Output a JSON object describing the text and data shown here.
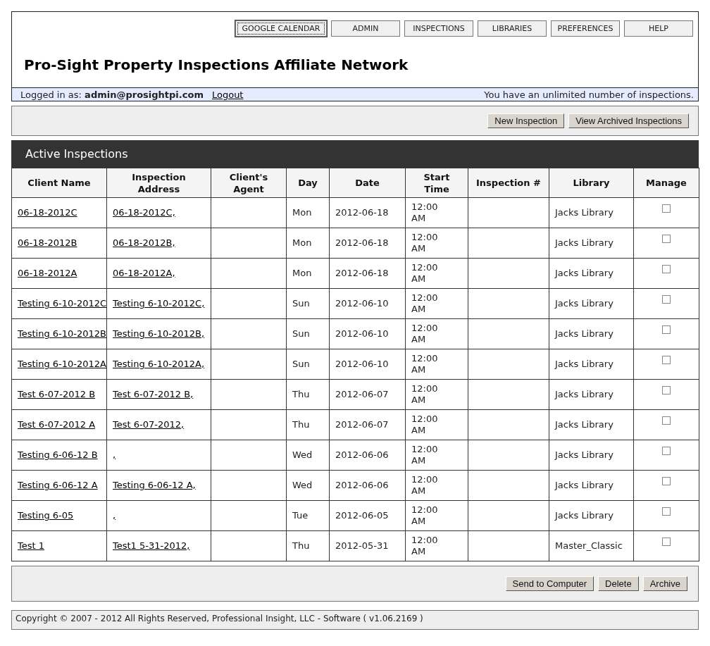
{
  "nav": [
    {
      "label": "GOOGLE CALENDAR",
      "focused": true
    },
    {
      "label": "ADMIN",
      "focused": false
    },
    {
      "label": "INSPECTIONS",
      "focused": false
    },
    {
      "label": "LIBRARIES",
      "focused": false
    },
    {
      "label": "PREFERENCES",
      "focused": false
    },
    {
      "label": "HELP",
      "focused": false
    }
  ],
  "site_title": "Pro-Sight Property Inspections Affiliate Network",
  "login_bar": {
    "label": "Logged in as:",
    "user": "admin@prosightpi.com",
    "logout": "Logout",
    "notice": "You have an unlimited number of inspections."
  },
  "top_actions": [
    "New Inspection",
    "View Archived Inspections"
  ],
  "table": {
    "title": "Active Inspections",
    "columns": [
      "Client Name",
      "Inspection Address",
      "Client's Agent",
      "Day",
      "Date",
      "Start Time",
      "Inspection #",
      "Library",
      "Manage"
    ],
    "rows": [
      {
        "client": "06-18-2012C",
        "address": "06-18-2012C,",
        "day": "Mon",
        "date": "2012-06-18",
        "time": "12:00 AM",
        "library": "Jacks Library",
        "checked": false
      },
      {
        "client": "06-18-2012B",
        "address": "06-18-2012B,",
        "day": "Mon",
        "date": "2012-06-18",
        "time": "12:00 AM",
        "library": "Jacks Library",
        "checked": false
      },
      {
        "client": "06-18-2012A",
        "address": "06-18-2012A,",
        "day": "Mon",
        "date": "2012-06-18",
        "time": "12:00 AM",
        "library": "Jacks Library",
        "checked": false
      },
      {
        "client": "Testing 6-10-2012C",
        "address": "Testing 6-10-2012C,",
        "day": "Sun",
        "date": "2012-06-10",
        "time": "12:00 AM",
        "library": "Jacks Library",
        "checked": false
      },
      {
        "client": "Testing 6-10-2012B",
        "address": "Testing 6-10-2012B,",
        "day": "Sun",
        "date": "2012-06-10",
        "time": "12:00 AM",
        "library": "Jacks Library",
        "checked": false
      },
      {
        "client": "Testing 6-10-2012A",
        "address": "Testing 6-10-2012A,",
        "day": "Sun",
        "date": "2012-06-10",
        "time": "12:00 AM",
        "library": "Jacks Library",
        "checked": false
      },
      {
        "client": "Test 6-07-2012 B",
        "address": "Test 6-07-2012 B,",
        "day": "Thu",
        "date": "2012-06-07",
        "time": "12:00 AM",
        "library": "Jacks Library",
        "checked": false
      },
      {
        "client": "Test 6-07-2012 A",
        "address": "Test 6-07-2012,",
        "day": "Thu",
        "date": "2012-06-07",
        "time": "12:00 AM",
        "library": "Jacks Library",
        "checked": false
      },
      {
        "client": "Testing 6-06-12 B",
        "address": ",",
        "day": "Wed",
        "date": "2012-06-06",
        "time": "12:00 AM",
        "library": "Jacks Library",
        "checked": false
      },
      {
        "client": "Testing 6-06-12 A",
        "address": "Testing 6-06-12 A,",
        "day": "Wed",
        "date": "2012-06-06",
        "time": "12:00 AM",
        "library": "Jacks Library",
        "checked": false
      },
      {
        "client": "Testing 6-05",
        "address": ",",
        "day": "Tue",
        "date": "2012-06-05",
        "time": "12:00 AM",
        "library": "Jacks Library",
        "checked": false
      },
      {
        "client": "Test 1",
        "address": "Test1 5-31-2012,",
        "day": "Thu",
        "date": "2012-05-31",
        "time": "12:00 AM",
        "library": "Master_Classic",
        "checked": false
      }
    ]
  },
  "bottom_actions": [
    "Send to Computer",
    "Delete",
    "Archive"
  ],
  "footer": "Copyright © 2007 - 2012 All Rights Reserved, Professional Insight, LLC - Software ( v1.06.2169 )"
}
